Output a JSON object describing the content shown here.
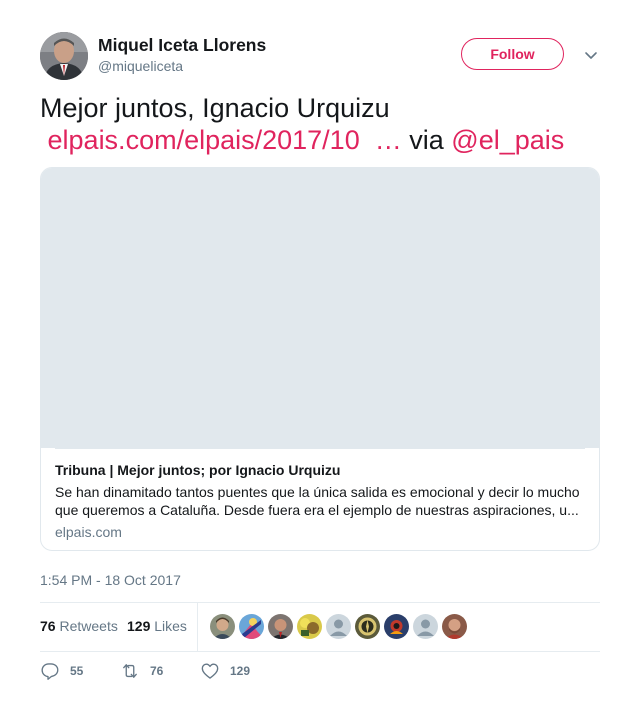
{
  "user": {
    "name": "Miquel Iceta Llorens",
    "handle": "@miqueliceta",
    "follow_label": "Follow"
  },
  "tweet": {
    "text_line1": "Mejor juntos, Ignacio Urquizu",
    "link_text": "elpais.com/elpais/2017/10",
    "ellipsis": "…",
    "via_text": "via",
    "mention": "@el_pais"
  },
  "card": {
    "title": "Tribuna | Mejor juntos; por Ignacio Urquizu",
    "description": "Se han dinamitado tantos puentes que la única salida es emocional y decir lo mucho que queremos a Cataluña. Desde fuera era el ejemplo de nuestras aspiraciones, u...",
    "domain": "elpais.com"
  },
  "timestamp": "1:54 PM - 18 Oct 2017",
  "stats": {
    "retweets_count": "76",
    "retweets_label": "Retweets",
    "likes_count": "129",
    "likes_label": "Likes"
  },
  "actions": {
    "replies": "55",
    "retweets": "76",
    "likes": "129"
  },
  "colors": {
    "accent": "#e0245e",
    "text": "#14171a",
    "muted": "#657786",
    "border": "#e1e8ed",
    "card_placeholder": "#e1e8ed"
  },
  "icons": [
    "chevron-down-icon",
    "reply-icon",
    "retweet-icon",
    "heart-icon"
  ]
}
